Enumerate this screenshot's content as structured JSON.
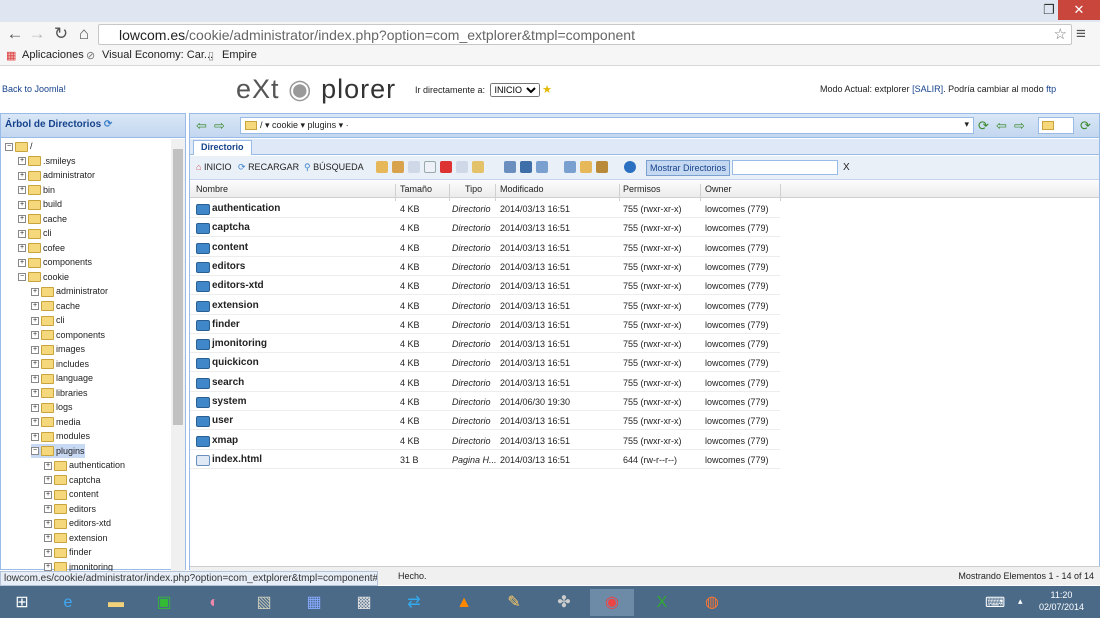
{
  "browser": {
    "url_host": "lowcom.es",
    "url_path": "/cookie/administrator/index.php?option=com_extplorer&tmpl=component",
    "bookmarks": [
      "Aplicaciones",
      "Visual Economy: Car...",
      "Empire"
    ],
    "status_url": "lowcom.es/cookie/administrator/index.php?option=com_extplorer&tmpl=component#"
  },
  "header": {
    "back_link": "Back to Joomla!",
    "logo_left": "eXt",
    "logo_right": "plorer",
    "goto_label": "Ir directamente a:",
    "goto_value": "INICIO",
    "mode_text": "Modo Actual: extplorer",
    "salir": "[SALIR]",
    "mode_switch": ". Podría cambiar al modo",
    "ftp": "ftp"
  },
  "tree": {
    "title": "Árbol de Directorios",
    "nodes": [
      {
        "label": "/",
        "level": 0,
        "open": true
      },
      {
        "label": ".smileys",
        "level": 1
      },
      {
        "label": "administrator",
        "level": 1
      },
      {
        "label": "bin",
        "level": 1
      },
      {
        "label": "build",
        "level": 1
      },
      {
        "label": "cache",
        "level": 1
      },
      {
        "label": "cli",
        "level": 1
      },
      {
        "label": "cofee",
        "level": 1
      },
      {
        "label": "components",
        "level": 1
      },
      {
        "label": "cookie",
        "level": 1,
        "open": true
      },
      {
        "label": "administrator",
        "level": 2
      },
      {
        "label": "cache",
        "level": 2
      },
      {
        "label": "cli",
        "level": 2
      },
      {
        "label": "components",
        "level": 2
      },
      {
        "label": "images",
        "level": 2
      },
      {
        "label": "includes",
        "level": 2
      },
      {
        "label": "language",
        "level": 2
      },
      {
        "label": "libraries",
        "level": 2
      },
      {
        "label": "logs",
        "level": 2
      },
      {
        "label": "media",
        "level": 2
      },
      {
        "label": "modules",
        "level": 2
      },
      {
        "label": "plugins",
        "level": 2,
        "open": true,
        "selected": true
      },
      {
        "label": "authentication",
        "level": 3
      },
      {
        "label": "captcha",
        "level": 3
      },
      {
        "label": "content",
        "level": 3
      },
      {
        "label": "editors",
        "level": 3
      },
      {
        "label": "editors-xtd",
        "level": 3
      },
      {
        "label": "extension",
        "level": 3
      },
      {
        "label": "finder",
        "level": 3
      },
      {
        "label": "jmonitoring",
        "level": 3
      }
    ]
  },
  "pathbar": {
    "path": "/ ▾  cookie ▾  plugins ▾  ·"
  },
  "tabs": {
    "directory": "Directorio"
  },
  "toolbar": {
    "home": "INICIO",
    "reload": "RECARGAR",
    "search": "BÚSQUEDA",
    "show_dirs": "Mostrar Directorios",
    "clear": "X"
  },
  "columns": [
    "Nombre",
    "Tamaño",
    "Tipo",
    "Modificado",
    "Permisos",
    "Owner"
  ],
  "files": [
    {
      "name": "authentication",
      "size": "4 KB",
      "type": "Directorio",
      "modified": "2014/03/13 16:51",
      "perms": "755 (rwxr-xr-x)",
      "owner": "lowcomes (779)",
      "kind": "dir"
    },
    {
      "name": "captcha",
      "size": "4 KB",
      "type": "Directorio",
      "modified": "2014/03/13 16:51",
      "perms": "755 (rwxr-xr-x)",
      "owner": "lowcomes (779)",
      "kind": "dir"
    },
    {
      "name": "content",
      "size": "4 KB",
      "type": "Directorio",
      "modified": "2014/03/13 16:51",
      "perms": "755 (rwxr-xr-x)",
      "owner": "lowcomes (779)",
      "kind": "dir"
    },
    {
      "name": "editors",
      "size": "4 KB",
      "type": "Directorio",
      "modified": "2014/03/13 16:51",
      "perms": "755 (rwxr-xr-x)",
      "owner": "lowcomes (779)",
      "kind": "dir"
    },
    {
      "name": "editors-xtd",
      "size": "4 KB",
      "type": "Directorio",
      "modified": "2014/03/13 16:51",
      "perms": "755 (rwxr-xr-x)",
      "owner": "lowcomes (779)",
      "kind": "dir"
    },
    {
      "name": "extension",
      "size": "4 KB",
      "type": "Directorio",
      "modified": "2014/03/13 16:51",
      "perms": "755 (rwxr-xr-x)",
      "owner": "lowcomes (779)",
      "kind": "dir"
    },
    {
      "name": "finder",
      "size": "4 KB",
      "type": "Directorio",
      "modified": "2014/03/13 16:51",
      "perms": "755 (rwxr-xr-x)",
      "owner": "lowcomes (779)",
      "kind": "dir"
    },
    {
      "name": "jmonitoring",
      "size": "4 KB",
      "type": "Directorio",
      "modified": "2014/03/13 16:51",
      "perms": "755 (rwxr-xr-x)",
      "owner": "lowcomes (779)",
      "kind": "dir"
    },
    {
      "name": "quickicon",
      "size": "4 KB",
      "type": "Directorio",
      "modified": "2014/03/13 16:51",
      "perms": "755 (rwxr-xr-x)",
      "owner": "lowcomes (779)",
      "kind": "dir"
    },
    {
      "name": "search",
      "size": "4 KB",
      "type": "Directorio",
      "modified": "2014/03/13 16:51",
      "perms": "755 (rwxr-xr-x)",
      "owner": "lowcomes (779)",
      "kind": "dir"
    },
    {
      "name": "system",
      "size": "4 KB",
      "type": "Directorio",
      "modified": "2014/06/30 19:30",
      "perms": "755 (rwxr-xr-x)",
      "owner": "lowcomes (779)",
      "kind": "dir"
    },
    {
      "name": "user",
      "size": "4 KB",
      "type": "Directorio",
      "modified": "2014/03/13 16:51",
      "perms": "755 (rwxr-xr-x)",
      "owner": "lowcomes (779)",
      "kind": "dir"
    },
    {
      "name": "xmap",
      "size": "4 KB",
      "type": "Directorio",
      "modified": "2014/03/13 16:51",
      "perms": "755 (rwxr-xr-x)",
      "owner": "lowcomes (779)",
      "kind": "dir"
    },
    {
      "name": "index.html",
      "size": "31 B",
      "type": "Pagina H...",
      "modified": "2014/03/13 16:51",
      "perms": "644 (rw-r--r--)",
      "owner": "lowcomes (779)",
      "kind": "file"
    }
  ],
  "status": {
    "hecho": "Hecho.",
    "count": "Mostrando Elementos 1 - 14 of 14"
  },
  "taskbar": {
    "time": "11:20",
    "date": "02/07/2014"
  }
}
